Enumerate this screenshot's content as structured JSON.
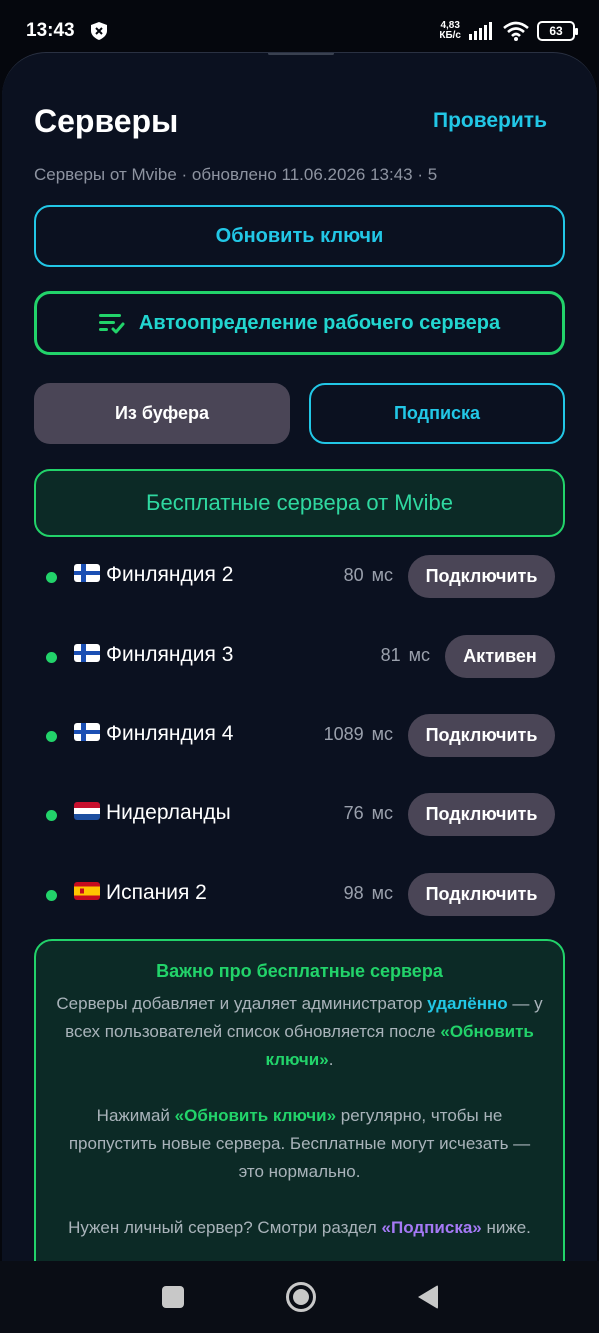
{
  "status_bar": {
    "time": "13:43",
    "net_speed_value": "4,83",
    "net_speed_unit": "КБ/с",
    "battery": "63"
  },
  "header": {
    "title": "Серверы",
    "check_label": "Проверить",
    "subtitle": "Серверы от Mvibe · обновлено 11.06.2026 13:43 · 5"
  },
  "actions": {
    "refresh_keys": "Обновить ключи",
    "auto_detect": "Автоопределение рабочего сервера",
    "from_clipboard": "Из буфера",
    "subscription": "Подписка"
  },
  "free_servers_banner": "Бесплатные сервера от Mvibe",
  "servers": [
    {
      "name": "Финляндия 2",
      "ping": "80",
      "unit": "мс",
      "action": "Подключить",
      "flag": "finland",
      "status": "online"
    },
    {
      "name": "Финляндия 3",
      "ping": "81",
      "unit": "мс",
      "action": "Активен",
      "flag": "finland",
      "status": "online"
    },
    {
      "name": "Финляндия 4",
      "ping": "1089",
      "unit": "мс",
      "action": "Подключить",
      "flag": "finland",
      "status": "online"
    },
    {
      "name": "Нидерланды",
      "ping": "76",
      "unit": "мс",
      "action": "Подключить",
      "flag": "netherlands",
      "status": "online"
    },
    {
      "name": "Испания 2",
      "ping": "98",
      "unit": "мс",
      "action": "Подключить",
      "flag": "spain",
      "status": "online"
    }
  ],
  "info": {
    "title": "Важно про бесплатные сервера",
    "p1_a": "Серверы добавляет и удаляет администратор ",
    "p1_hl": "удалённо",
    "p1_b": " — у всех пользователей список обновляется после ",
    "p1_hl2": "«Обновить ключи»",
    "p1_c": ".",
    "p2_a": "Нажимай ",
    "p2_hl": "«Обновить ключи»",
    "p2_b": " регулярно, чтобы не пропустить новые сервера. Бесплатные могут исчезать — это нормально.",
    "p3_a": "Нужен личный сервер? Смотри раздел ",
    "p3_hl": "«Подписка»",
    "p3_b": " ниже."
  },
  "colors": {
    "accent_cyan": "#22c7e6",
    "accent_green": "#22d36a",
    "accent_purple": "#a579f5",
    "background": "#0b1120",
    "button_gray": "#4a4556"
  },
  "icons": {
    "auto_detect": "filter-lines-icon",
    "nav_recents": "square-icon",
    "nav_home": "circle-icon",
    "nav_back": "triangle-back-icon"
  }
}
